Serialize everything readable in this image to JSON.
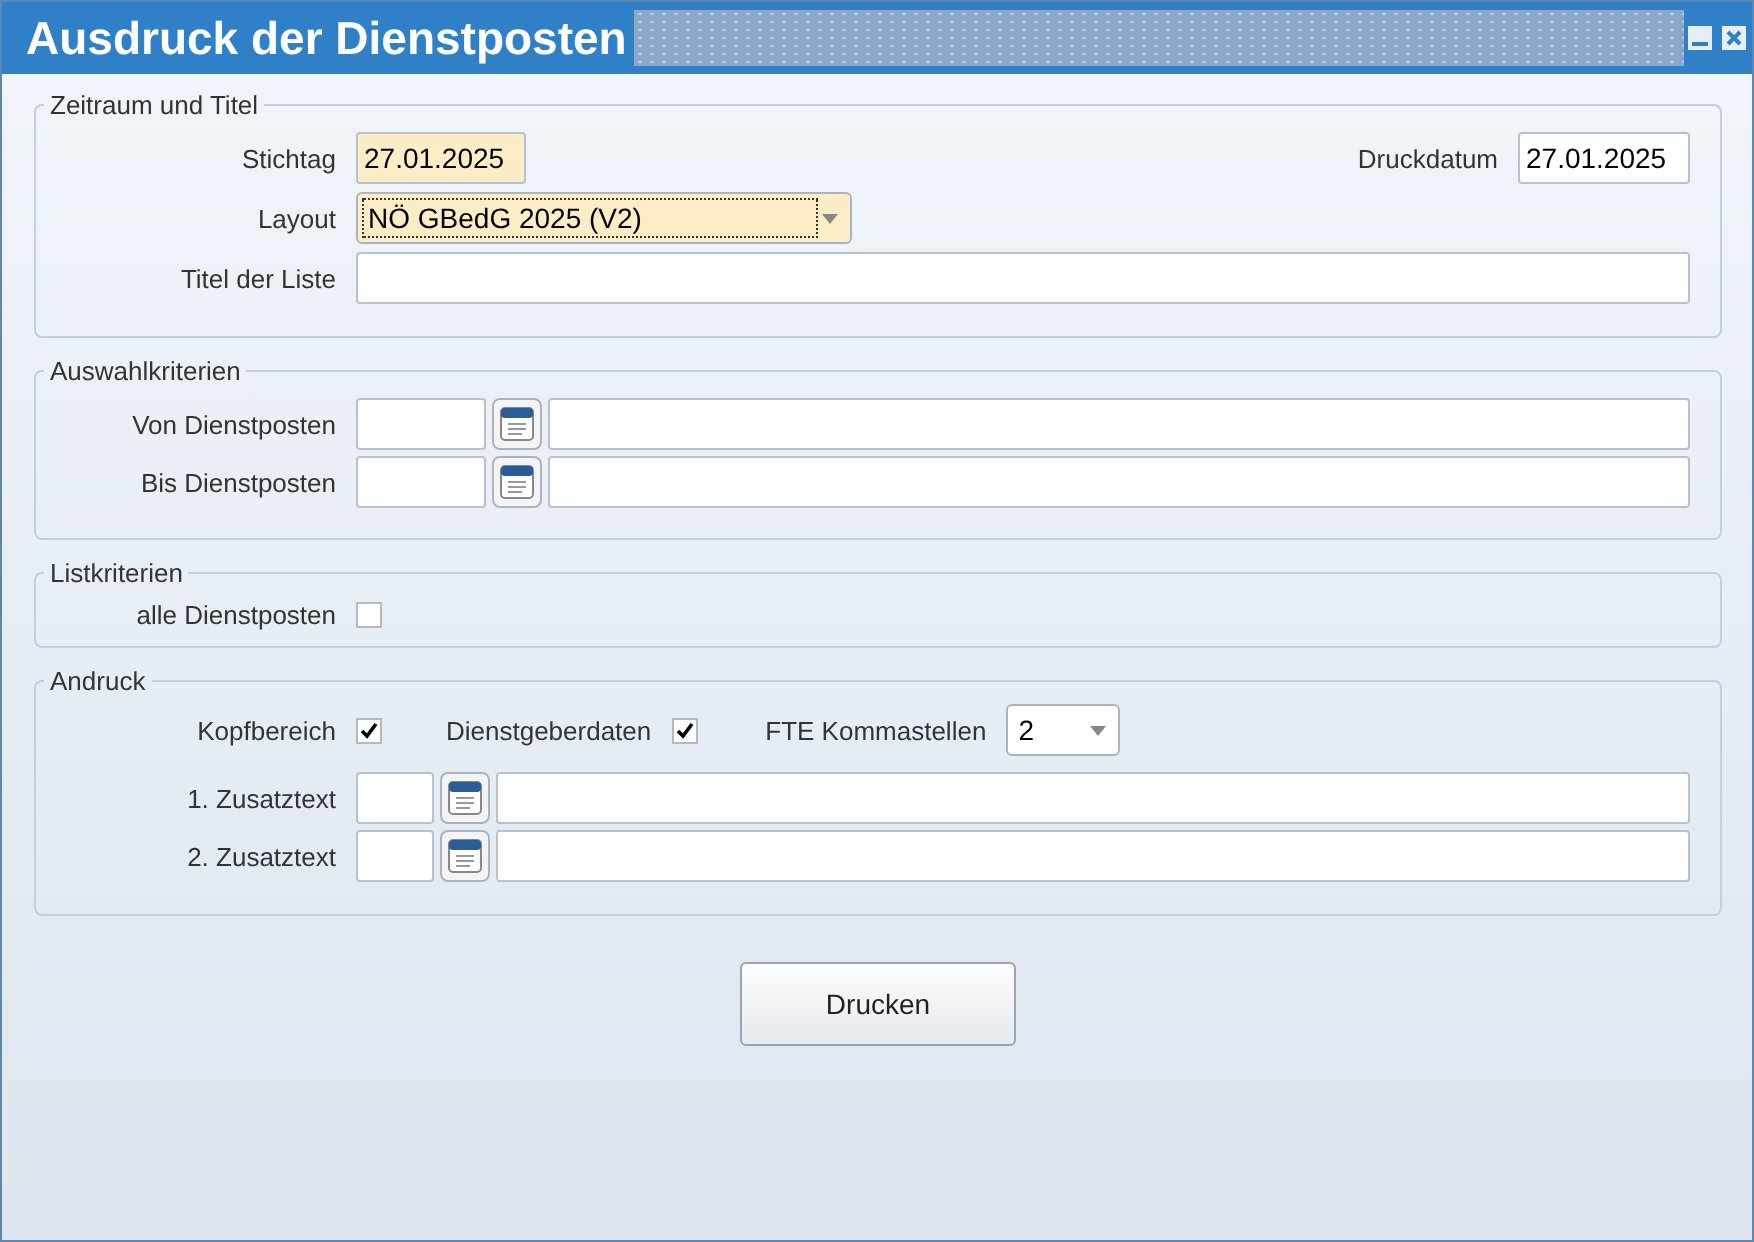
{
  "window": {
    "title": "Ausdruck der Dienstposten"
  },
  "zeitraum": {
    "legend": "Zeitraum und Titel",
    "stichtag": {
      "label": "Stichtag",
      "value": "27.01.2025",
      "highlighted": true
    },
    "druckdatum": {
      "label": "Druckdatum",
      "value": "27.01.2025",
      "highlighted": false
    },
    "layout": {
      "label": "Layout",
      "value": "NÖ GBedG 2025 (V2)",
      "highlighted": true
    },
    "titel": {
      "label": "Titel der Liste"
    }
  },
  "auswahl": {
    "legend": "Auswahlkriterien",
    "rows": [
      {
        "label": "Von Dienstposten"
      },
      {
        "label": "Bis Dienstposten"
      }
    ]
  },
  "listkriterien": {
    "legend": "Listkriterien",
    "options": [
      {
        "label": "alle Dienstposten",
        "checked": false
      }
    ]
  },
  "andruck": {
    "legend": "Andruck",
    "options": [
      {
        "label": "Kopfbereich",
        "checked": true
      },
      {
        "label": "Dienstgeberdaten",
        "checked": true
      }
    ],
    "fte": {
      "label": "FTE Kommastellen",
      "value": "2"
    },
    "zusatz": [
      {
        "label": "1. Zusatztext"
      },
      {
        "label": "2. Zusatztext"
      }
    ]
  },
  "button": {
    "label": "Drucken"
  }
}
